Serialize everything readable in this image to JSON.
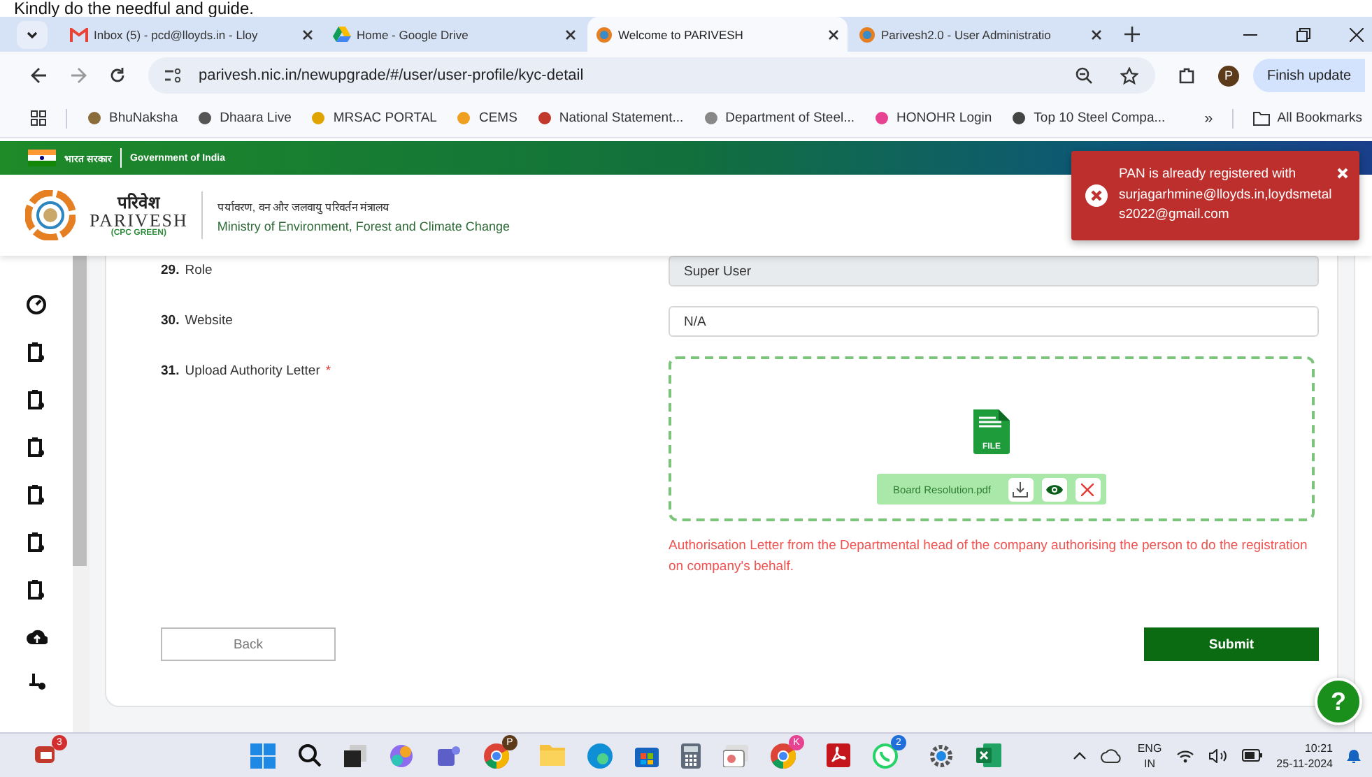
{
  "caption": "Kindly do the needful and guide.",
  "browser": {
    "tabs": [
      {
        "title": "Inbox (5) - pcd@lloyds.in - Lloy",
        "kind": "mail",
        "selected": false
      },
      {
        "title": "Home - Google Drive",
        "kind": "drive",
        "selected": false
      },
      {
        "title": "Welcome to PARIVESH",
        "kind": "site",
        "selected": true
      },
      {
        "title": "Parivesh2.0 - User Administratio",
        "kind": "site",
        "selected": false
      }
    ],
    "url": "parivesh.nic.in/newupgrade/#/user/user-profile/kyc-detail",
    "profile_initial": "P",
    "update_button": "Finish update",
    "bookmarks": [
      "BhuNaksha",
      "Dhaara Live",
      "MRSAC PORTAL",
      "CEMS",
      "National Statement...",
      "Department of Steel...",
      "HONOHR Login",
      "Top 10 Steel Compa..."
    ],
    "bookmarks_more": "»",
    "all_bookmarks": "All Bookmarks"
  },
  "gov_bar": {
    "hindi": "भारत सरकार",
    "english": "Government of India"
  },
  "header": {
    "logo_hindi": "परिवेश",
    "logo_name": "PARIVESH",
    "logo_sub": "(CPC GREEN)",
    "ministry_hindi": "पर्यावरण, वन और जलवायु परिवर्तन मंत्रालय",
    "ministry_english": "Ministry of Environment, Forest and Climate Change"
  },
  "form": {
    "fields": [
      {
        "kind": "input",
        "number": "29.",
        "label": "Role",
        "value": "Super User",
        "disabled": true
      },
      {
        "kind": "input",
        "number": "30.",
        "label": "Website",
        "value": "N/A",
        "disabled": false
      },
      {
        "kind": "upload",
        "number": "31.",
        "label": "Upload Authority Letter",
        "required_mark": "*",
        "file_badge": "FILE",
        "file_name": "Board Resolution.pdf",
        "hint": "Authorisation Letter from the Departmental head of the company authorising the person to do the registration on company's behalf."
      }
    ],
    "back_button": "Back",
    "submit_button": "Submit"
  },
  "toast": {
    "message": "PAN is already registered with surjagarhmine@lloyds.in,loydsmetals2022@gmail.com"
  },
  "help_button": "?",
  "taskbar": {
    "widget_badge": "3",
    "chrome_badge": "P",
    "chrome2_badge": "K",
    "whatsapp_badge": "2",
    "language": "ENG",
    "region": "IN",
    "time": "10:21",
    "date": "25-11-2024"
  }
}
